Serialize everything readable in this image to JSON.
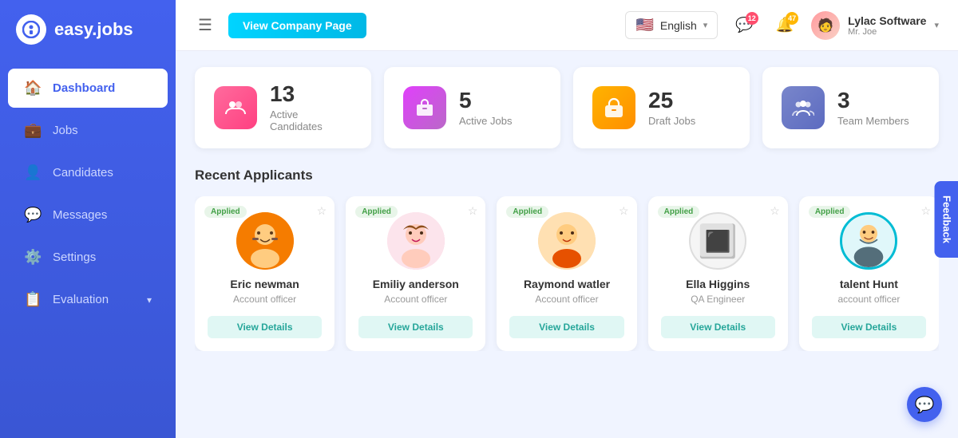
{
  "app": {
    "name": "easy.jobs",
    "logo_char": "i"
  },
  "sidebar": {
    "items": [
      {
        "id": "dashboard",
        "label": "Dashboard",
        "icon": "🏠",
        "active": true
      },
      {
        "id": "jobs",
        "label": "Jobs",
        "icon": "👜",
        "active": false
      },
      {
        "id": "candidates",
        "label": "Candidates",
        "icon": "👤",
        "active": false
      },
      {
        "id": "messages",
        "label": "Messages",
        "icon": "💬",
        "active": false
      },
      {
        "id": "settings",
        "label": "Settings",
        "icon": "⚙️",
        "active": false
      },
      {
        "id": "evaluation",
        "label": "Evaluation",
        "icon": "📋",
        "active": false,
        "has_arrow": true
      }
    ]
  },
  "header": {
    "view_company_btn": "View Company Page",
    "language": "English",
    "notifications": {
      "messages_count": "12",
      "alerts_count": "47"
    },
    "user": {
      "name": "Lylac Software",
      "sub": "Mr. Joe"
    }
  },
  "stats": [
    {
      "id": "active-candidates",
      "number": "13",
      "label": "Active Candidates",
      "icon": "👥",
      "color": "pink"
    },
    {
      "id": "active-jobs",
      "number": "5",
      "label": "Active Jobs",
      "icon": "💼",
      "color": "magenta"
    },
    {
      "id": "draft-jobs",
      "number": "25",
      "label": "Draft Jobs",
      "icon": "🧳",
      "color": "orange"
    },
    {
      "id": "team-members",
      "number": "3",
      "label": "Team Members",
      "icon": "👥",
      "color": "purple"
    }
  ],
  "recent_applicants": {
    "title": "Recent Applicants",
    "applicants": [
      {
        "id": "eric",
        "name": "Eric newman",
        "role": "Account officer",
        "status": "Applied",
        "avatar_emoji": "🧔",
        "avatar_class": "avatar-eric"
      },
      {
        "id": "emily",
        "name": "Emiliy anderson",
        "role": "Account officer",
        "status": "Applied",
        "avatar_emoji": "👩",
        "avatar_class": "avatar-emily"
      },
      {
        "id": "raymond",
        "name": "Raymond watler",
        "role": "Account officer",
        "status": "Applied",
        "avatar_emoji": "👨",
        "avatar_class": "avatar-raymond"
      },
      {
        "id": "ella",
        "name": "Ella Higgins",
        "role": "QA Engineer",
        "status": "Applied",
        "avatar_emoji": "🔳",
        "avatar_class": "avatar-ella"
      },
      {
        "id": "talent",
        "name": "talent Hunt",
        "role": "account officer",
        "status": "Applied",
        "avatar_emoji": "👨‍💼",
        "avatar_class": "avatar-talent"
      }
    ],
    "view_details_label": "View Details"
  },
  "feedback_tab": "Feedback",
  "chat_icon": "💬"
}
